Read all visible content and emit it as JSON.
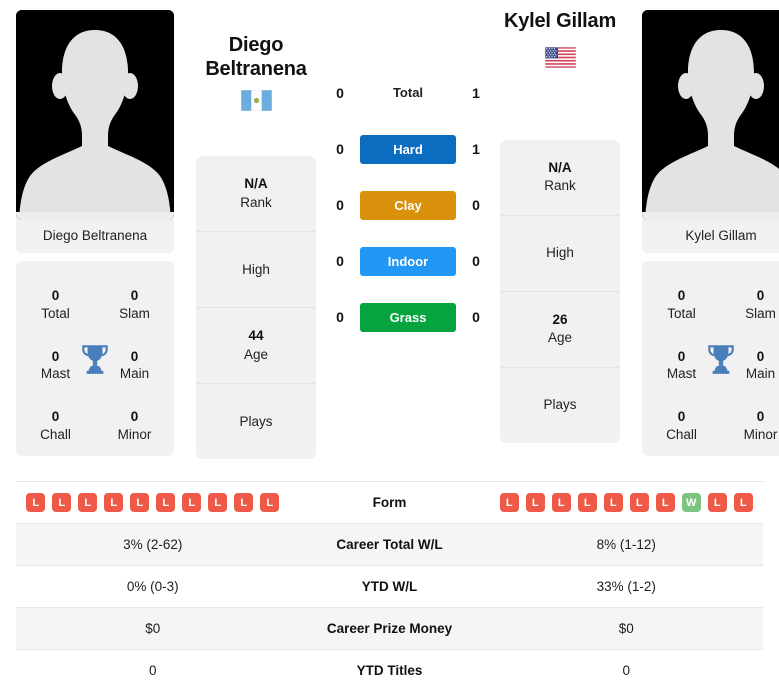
{
  "players": {
    "left": {
      "name_line1": "Diego",
      "name_line2": "Beltranena",
      "photo_caption": "Diego Beltranena",
      "flag": "guatemala-flag",
      "titles": [
        {
          "num": "0",
          "label": "Total"
        },
        {
          "num": "0",
          "label": "Slam"
        },
        {
          "num": "0",
          "label": "Mast"
        },
        {
          "num": "0",
          "label": "Main"
        },
        {
          "num": "0",
          "label": "Chall"
        },
        {
          "num": "0",
          "label": "Minor"
        }
      ],
      "profile": {
        "rank_value": "N/A",
        "rank_label": "Rank",
        "high_value": "",
        "high_label": "High",
        "age_value": "44",
        "age_label": "Age",
        "plays_value": "",
        "plays_label": "Plays"
      }
    },
    "right": {
      "name_line1": "Kylel Gillam",
      "name_line2": "",
      "photo_caption": "Kylel Gillam",
      "flag": "usa-flag",
      "titles": [
        {
          "num": "0",
          "label": "Total"
        },
        {
          "num": "0",
          "label": "Slam"
        },
        {
          "num": "0",
          "label": "Mast"
        },
        {
          "num": "0",
          "label": "Main"
        },
        {
          "num": "0",
          "label": "Chall"
        },
        {
          "num": "0",
          "label": "Minor"
        }
      ],
      "profile": {
        "rank_value": "N/A",
        "rank_label": "Rank",
        "high_value": "",
        "high_label": "High",
        "age_value": "26",
        "age_label": "Age",
        "plays_value": "",
        "plays_label": "Plays"
      }
    }
  },
  "h2h": [
    {
      "left": "0",
      "label": "Total",
      "right": "1",
      "style": "plain",
      "color": ""
    },
    {
      "left": "0",
      "label": "Hard",
      "right": "1",
      "style": "pill",
      "color": "#0c6cbf"
    },
    {
      "left": "0",
      "label": "Clay",
      "right": "0",
      "style": "pill",
      "color": "#d9900a"
    },
    {
      "left": "0",
      "label": "Indoor",
      "right": "0",
      "style": "pill",
      "color": "#2196f3"
    },
    {
      "left": "0",
      "label": "Grass",
      "right": "0",
      "style": "pill",
      "color": "#07a33f"
    }
  ],
  "form": {
    "label": "Form",
    "left": [
      "L",
      "L",
      "L",
      "L",
      "L",
      "L",
      "L",
      "L",
      "L",
      "L"
    ],
    "right": [
      "L",
      "L",
      "L",
      "L",
      "L",
      "L",
      "L",
      "W",
      "L",
      "L"
    ],
    "win_color": "#7cc47f",
    "loss_color": "#ee5a47"
  },
  "stats_rows": [
    {
      "left": "3% (2-62)",
      "label": "Career Total W/L",
      "right": "8% (1-12)"
    },
    {
      "left": "0% (0-3)",
      "label": "YTD W/L",
      "right": "33% (1-2)"
    },
    {
      "left": "$0",
      "label": "Career Prize Money",
      "right": "$0"
    },
    {
      "left": "0",
      "label": "YTD Titles",
      "right": "0"
    }
  ]
}
